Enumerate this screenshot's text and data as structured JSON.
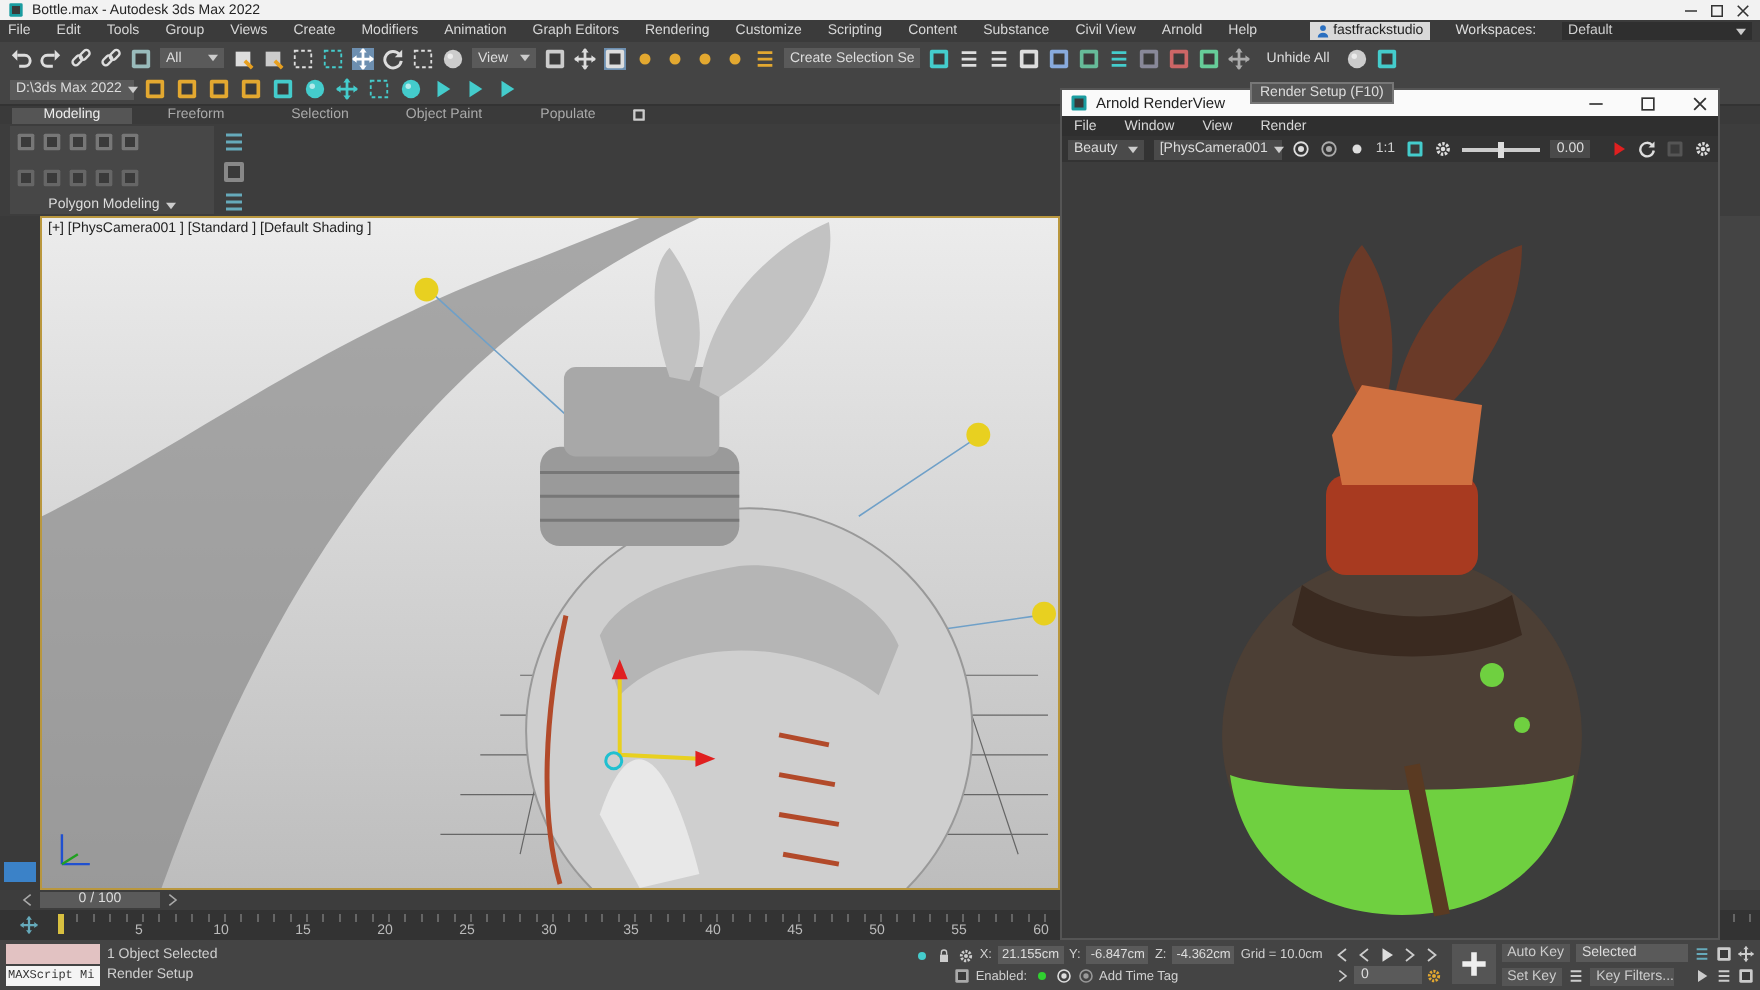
{
  "window": {
    "title": "Bottle.max - Autodesk 3ds Max 2022"
  },
  "menu": [
    "File",
    "Edit",
    "Tools",
    "Group",
    "Views",
    "Create",
    "Modifiers",
    "Animation",
    "Graph Editors",
    "Rendering",
    "Customize",
    "Scripting",
    "Content",
    "Substance",
    "Civil View",
    "Arnold",
    "Help"
  ],
  "user": {
    "name": "fastfrackstudio"
  },
  "workspaces": {
    "label": "Workspaces:",
    "value": "Default"
  },
  "toolbar": {
    "filter": "All",
    "reference": "View",
    "selection_set": "Create Selection Se",
    "unhide": "Unhide All",
    "project": "D:\\3ds Max 2022"
  },
  "tooltip": "Render Setup  (F10)",
  "ribbon": {
    "tabs": [
      {
        "label": "Modeling",
        "selected": true
      },
      {
        "label": "Freeform",
        "selected": false
      },
      {
        "label": "Selection",
        "selected": false
      },
      {
        "label": "Object Paint",
        "selected": false
      },
      {
        "label": "Populate",
        "selected": false
      }
    ],
    "panel": "Polygon Modeling"
  },
  "viewport": {
    "label": "[+] [PhysCamera001 ] [Standard ] [Default Shading ]"
  },
  "render_view": {
    "title": "Arnold RenderView",
    "menu": [
      "File",
      "Window",
      "View",
      "Render"
    ],
    "aov": "Beauty",
    "camera": "[PhysCamera001",
    "ratio": "1:1",
    "exposure": "0.00",
    "exposure_slider": {
      "level": 0.5
    }
  },
  "timeline": {
    "position": "0 / 100",
    "slider": {
      "level": 0
    },
    "ticks": [
      "5",
      "10",
      "15",
      "20",
      "25",
      "30",
      "35",
      "40",
      "45",
      "50",
      "55",
      "60"
    ]
  },
  "status": {
    "script": "MAXScript Mi",
    "selection": "1 Object Selected",
    "prompt": "Render Setup",
    "x_label": "X:",
    "x": "21.155cm",
    "y_label": "Y:",
    "y": "-6.847cm",
    "z_label": "Z:",
    "z": "-4.362cm",
    "grid": "Grid = 10.0cm",
    "enabled": "Enabled:",
    "time_tag": "Add Time Tag",
    "frame": "0",
    "auto_key": "Auto Key",
    "key_mode": "Selected",
    "set_key": "Set Key",
    "key_filters": "Key Filters..."
  }
}
